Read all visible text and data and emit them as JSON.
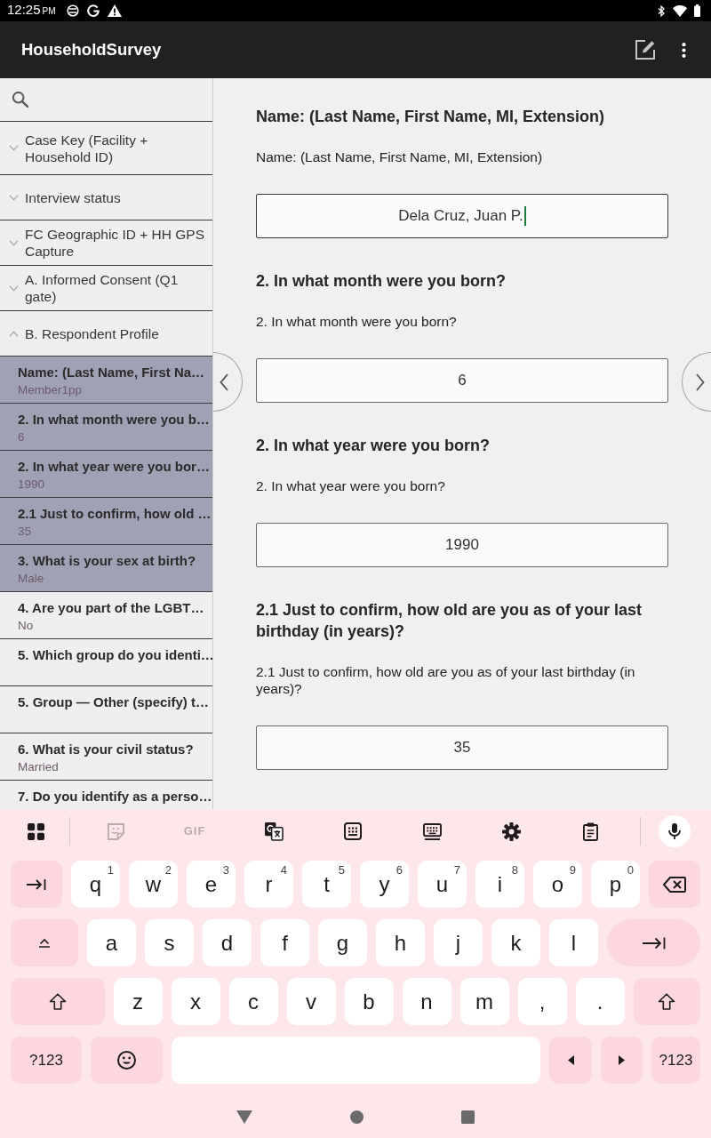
{
  "status_bar": {
    "time": "12:25",
    "period": "PM"
  },
  "app_bar": {
    "title": "HouseholdSurvey"
  },
  "sidebar": {
    "sections": [
      {
        "label": "Case Key (Facility + Household ID)",
        "expanded": false
      },
      {
        "label": "Interview status",
        "expanded": false
      },
      {
        "label": "FC Geographic ID + HH GPS Capture",
        "expanded": false
      },
      {
        "label": "A. Informed Consent (Q1 gate)",
        "expanded": false
      },
      {
        "label": "B. Respondent Profile",
        "expanded": true,
        "children": [
          {
            "question": "Name: (Last Name, First Na…",
            "answer": "Member1pp",
            "selected": true
          },
          {
            "question": "2. In what month were you b…",
            "answer": "6",
            "selected": true
          },
          {
            "question": "2. In what year were you bor…",
            "answer": "1990",
            "selected": true
          },
          {
            "question": "2.1 Just to confirm, how old …",
            "answer": "35",
            "selected": true
          },
          {
            "question": "3. What is your sex at birth?",
            "answer": "Male",
            "selected": true
          },
          {
            "question": "4. Are you part of the LGBT…",
            "answer": "No",
            "selected": false
          },
          {
            "question": "5. Which group do you identi…",
            "selected": false
          },
          {
            "question": "5. Group — Other (specify) t…",
            "selected": false
          },
          {
            "question": "6. What is your civil status?",
            "answer": "Married",
            "selected": false
          },
          {
            "question": "7. Do you identify as a perso…",
            "selected": false
          }
        ]
      }
    ]
  },
  "form": {
    "questions": [
      {
        "title": "Name: (Last Name, First Name, MI, Extension)",
        "label": "Name: (Last Name, First Name, MI, Extension)",
        "value": "Dela Cruz, Juan P.",
        "focused": true
      },
      {
        "title": "2. In what month were you born?",
        "label": "2. In what month were you born?",
        "value": "6",
        "focused": false
      },
      {
        "title": "2. In what year were you born?",
        "label": "2. In what year were you born?",
        "value": "1990",
        "focused": false
      },
      {
        "title": "2.1 Just to confirm, how old are you as of your last birthday (in years)?",
        "label": "2.1 Just to confirm, how old are you as of your last birthday (in years)?",
        "value": "35",
        "focused": false
      }
    ]
  },
  "keyboard": {
    "toolbar": [
      {
        "kind": "apps",
        "disabled": false
      },
      {
        "kind": "sticker",
        "disabled": true
      },
      {
        "kind": "gif",
        "label": "GIF",
        "disabled": true
      },
      {
        "kind": "translate",
        "disabled": false
      },
      {
        "kind": "numpad",
        "disabled": false
      },
      {
        "kind": "keyboard",
        "disabled": false
      },
      {
        "kind": "settings",
        "disabled": false
      },
      {
        "kind": "clipboard",
        "disabled": false
      },
      {
        "kind": "mic",
        "disabled": false
      }
    ],
    "rows": [
      [
        {
          "kind": "tab"
        },
        {
          "kind": "char",
          "label": "q",
          "hint": "1"
        },
        {
          "kind": "char",
          "label": "w",
          "hint": "2"
        },
        {
          "kind": "char",
          "label": "e",
          "hint": "3"
        },
        {
          "kind": "char",
          "label": "r",
          "hint": "4"
        },
        {
          "kind": "char",
          "label": "t",
          "hint": "5"
        },
        {
          "kind": "char",
          "label": "y",
          "hint": "6"
        },
        {
          "kind": "char",
          "label": "u",
          "hint": "7"
        },
        {
          "kind": "char",
          "label": "i",
          "hint": "8"
        },
        {
          "kind": "char",
          "label": "o",
          "hint": "9"
        },
        {
          "kind": "char",
          "label": "p",
          "hint": "0"
        },
        {
          "kind": "backspace"
        }
      ],
      [
        {
          "kind": "layout"
        },
        {
          "kind": "char",
          "label": "a"
        },
        {
          "kind": "char",
          "label": "s"
        },
        {
          "kind": "char",
          "label": "d"
        },
        {
          "kind": "char",
          "label": "f"
        },
        {
          "kind": "char",
          "label": "g"
        },
        {
          "kind": "char",
          "label": "h"
        },
        {
          "kind": "char",
          "label": "j"
        },
        {
          "kind": "char",
          "label": "k"
        },
        {
          "kind": "char",
          "label": "l"
        },
        {
          "kind": "enter"
        }
      ],
      [
        {
          "kind": "shift"
        },
        {
          "kind": "char",
          "label": "z"
        },
        {
          "kind": "char",
          "label": "x"
        },
        {
          "kind": "char",
          "label": "c"
        },
        {
          "kind": "char",
          "label": "v"
        },
        {
          "kind": "char",
          "label": "b"
        },
        {
          "kind": "char",
          "label": "n"
        },
        {
          "kind": "char",
          "label": "m"
        },
        {
          "kind": "char",
          "label": ","
        },
        {
          "kind": "char",
          "label": "."
        },
        {
          "kind": "shift"
        }
      ],
      [
        {
          "kind": "symbols",
          "label": "?123"
        },
        {
          "kind": "emoji"
        },
        {
          "kind": "space"
        },
        {
          "kind": "left"
        },
        {
          "kind": "right"
        },
        {
          "kind": "symbols",
          "label": "?123"
        }
      ]
    ]
  }
}
